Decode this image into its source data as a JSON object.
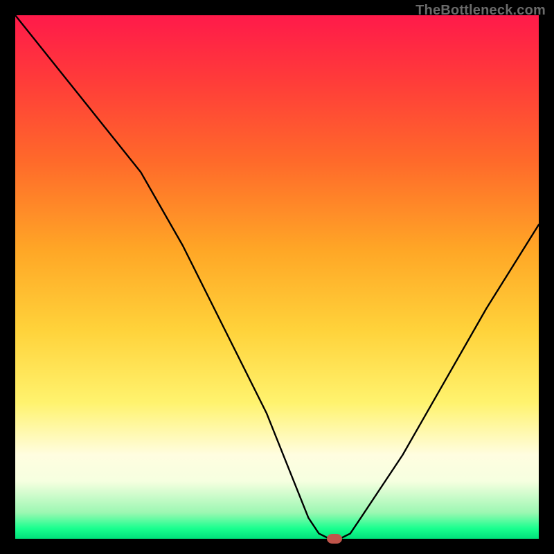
{
  "watermark": "TheBottleneck.com",
  "colors": {
    "frame": "#000000",
    "curve": "#000000",
    "marker": "#c0554b"
  },
  "chart_data": {
    "type": "line",
    "title": "",
    "xlabel": "",
    "ylabel": "",
    "x_range": [
      0,
      100
    ],
    "y_range": [
      0,
      100
    ],
    "grid": false,
    "legend": false,
    "series": [
      {
        "name": "bottleneck-curve",
        "x": [
          0,
          8,
          16,
          24,
          32,
          40,
          48,
          56,
          58,
          60,
          62,
          64,
          66,
          74,
          82,
          90,
          100
        ],
        "y": [
          100,
          90,
          80,
          70,
          56,
          40,
          24,
          4,
          1,
          0,
          0,
          1,
          4,
          16,
          30,
          44,
          60
        ]
      }
    ],
    "marker": {
      "x": 61,
      "y": 0
    },
    "background": {
      "type": "vertical-gradient",
      "stops": [
        {
          "pos": 0.0,
          "color": "#ff1a4a"
        },
        {
          "pos": 0.12,
          "color": "#ff3a3a"
        },
        {
          "pos": 0.28,
          "color": "#ff6a2a"
        },
        {
          "pos": 0.45,
          "color": "#ffa726"
        },
        {
          "pos": 0.6,
          "color": "#ffd23a"
        },
        {
          "pos": 0.74,
          "color": "#fff36e"
        },
        {
          "pos": 0.84,
          "color": "#fffde0"
        },
        {
          "pos": 0.89,
          "color": "#f6ffe0"
        },
        {
          "pos": 0.95,
          "color": "#9cf7b2"
        },
        {
          "pos": 0.98,
          "color": "#1aff8f"
        },
        {
          "pos": 1.0,
          "color": "#00e07a"
        }
      ]
    }
  }
}
